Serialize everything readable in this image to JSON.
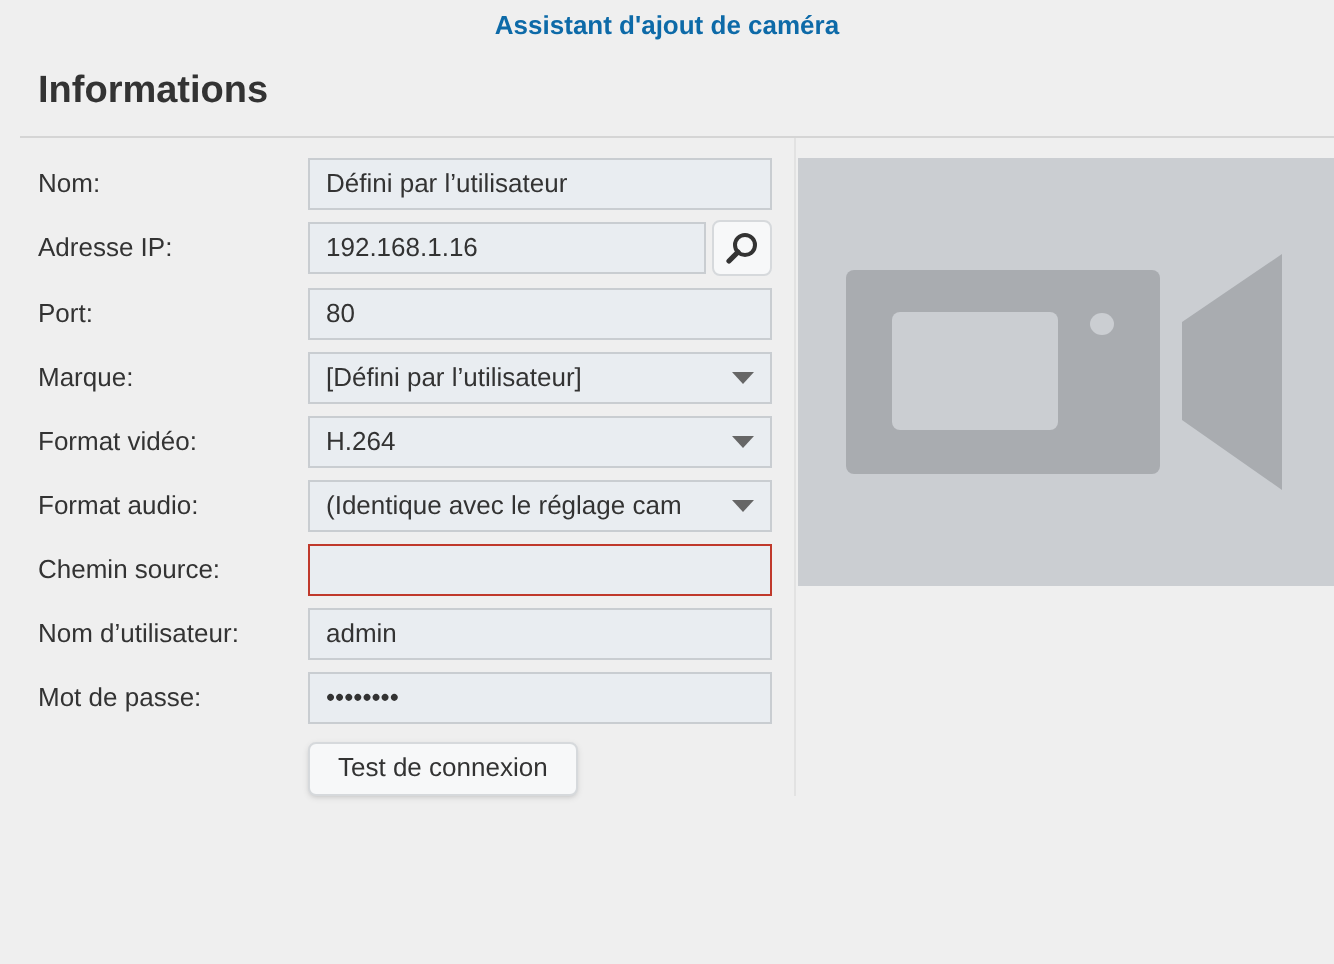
{
  "window": {
    "title": "Assistant d'ajout de caméra"
  },
  "section": {
    "title": "Informations"
  },
  "fields": [
    {
      "label": "Nom:",
      "kind": "text",
      "value": "Défini par l’utilisateur",
      "invalid": false
    },
    {
      "label": "Adresse IP:",
      "kind": "search",
      "value": "192.168.1.16",
      "invalid": false
    },
    {
      "label": "Port:",
      "kind": "text",
      "value": "80",
      "invalid": false
    },
    {
      "label": "Marque:",
      "kind": "select",
      "value": "[Défini par l’utilisateur]",
      "invalid": false
    },
    {
      "label": "Format vidéo:",
      "kind": "select",
      "value": "H.264",
      "invalid": false
    },
    {
      "label": "Format audio:",
      "kind": "select",
      "value": "(Identique avec le réglage cam",
      "invalid": false
    },
    {
      "label": "Chemin source:",
      "kind": "text",
      "invalid": true
    },
    {
      "label": "Nom d’utilisateur:",
      "kind": "text",
      "value": "admin",
      "invalid": false
    },
    {
      "label": "Mot de passe:",
      "kind": "text",
      "value": "••••••••",
      "invalid": false
    }
  ],
  "test_button": "Test de connexion",
  "preview": {
    "kind": "camera-placeholder"
  }
}
